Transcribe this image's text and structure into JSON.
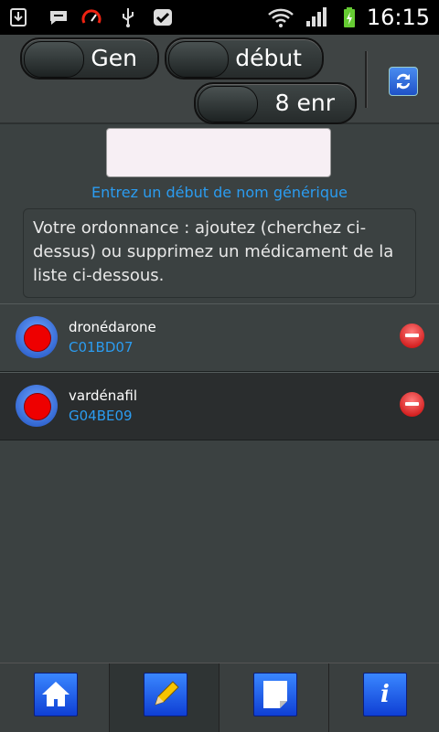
{
  "status_bar": {
    "time": "16:15",
    "icons": [
      "download-icon",
      "chat-icon",
      "speedometer-icon",
      "usb-icon",
      "check-icon",
      "wifi-icon",
      "signal-icon",
      "battery-icon"
    ]
  },
  "toolbar": {
    "gen_label": "Gen",
    "debut_label": "début",
    "count_label": "8 enr",
    "refresh_icon": "refresh-icon"
  },
  "search": {
    "value": "",
    "hint": "Entrez un début de nom générique"
  },
  "info_text": "Votre ordonnance : ajoutez (cherchez ci-dessus) ou supprimez un médicament de la liste ci-dessous.",
  "medications": [
    {
      "name": "dronédarone",
      "code": "C01BD07"
    },
    {
      "name": "vardénafil",
      "code": "G04BE09"
    }
  ],
  "bottom_nav": [
    "home-icon",
    "edit-icon",
    "note-icon",
    "info-icon"
  ],
  "colors": {
    "accent_blue": "#2b9cf0",
    "remove_red": "#cc0000",
    "pill_red": "#ee0000"
  }
}
